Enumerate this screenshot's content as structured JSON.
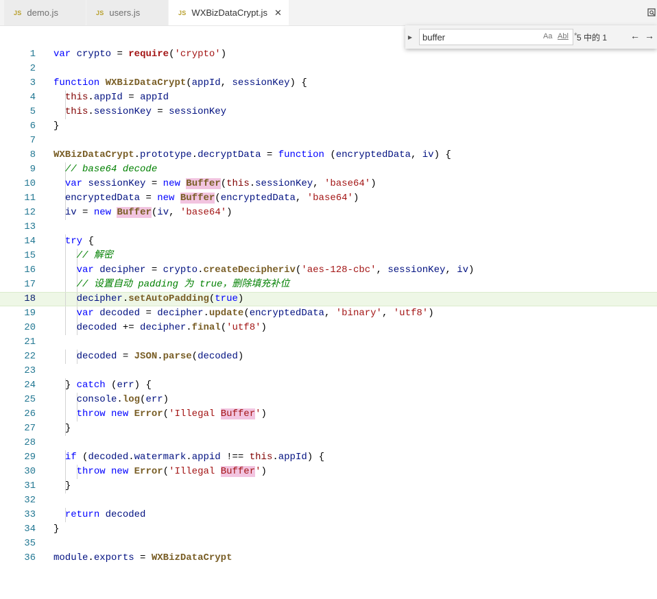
{
  "tabs": [
    {
      "label": "demo.js",
      "icon": "JS",
      "active": false
    },
    {
      "label": "users.js",
      "icon": "JS",
      "active": false
    },
    {
      "label": "WXBizDataCrypt.js",
      "icon": "JS",
      "active": true
    }
  ],
  "find_widget": {
    "query": "buffer",
    "options": [
      "Aa",
      "Abl",
      "*"
    ],
    "match_count": "5 中的 1"
  },
  "current_line": 18,
  "code_lines": [
    "var crypto = require('crypto')",
    "",
    "function WXBizDataCrypt(appId, sessionKey) {",
    "  this.appId = appId",
    "  this.sessionKey = sessionKey",
    "}",
    "",
    "WXBizDataCrypt.prototype.decryptData = function (encryptedData, iv) {",
    "  // base64 decode",
    "  var sessionKey = new Buffer(this.sessionKey, 'base64')",
    "  encryptedData = new Buffer(encryptedData, 'base64')",
    "  iv = new Buffer(iv, 'base64')",
    "",
    "  try {",
    "    // 解密",
    "    var decipher = crypto.createDecipheriv('aes-128-cbc', sessionKey, iv)",
    "    // 设置自动 padding 为 true，删除填充补位",
    "    decipher.setAutoPadding(true)",
    "    var decoded = decipher.update(encryptedData, 'binary', 'utf8')",
    "    decoded += decipher.final('utf8')",
    "",
    "    decoded = JSON.parse(decoded)",
    "",
    "  } catch (err) {",
    "    console.log(err)",
    "    throw new Error('Illegal Buffer')",
    "  }",
    "",
    "  if (decoded.watermark.appid !== this.appId) {",
    "    throw new Error('Illegal Buffer')",
    "  }",
    "",
    "  return decoded",
    "}",
    "",
    "module.exports = WXBizDataCrypt"
  ]
}
